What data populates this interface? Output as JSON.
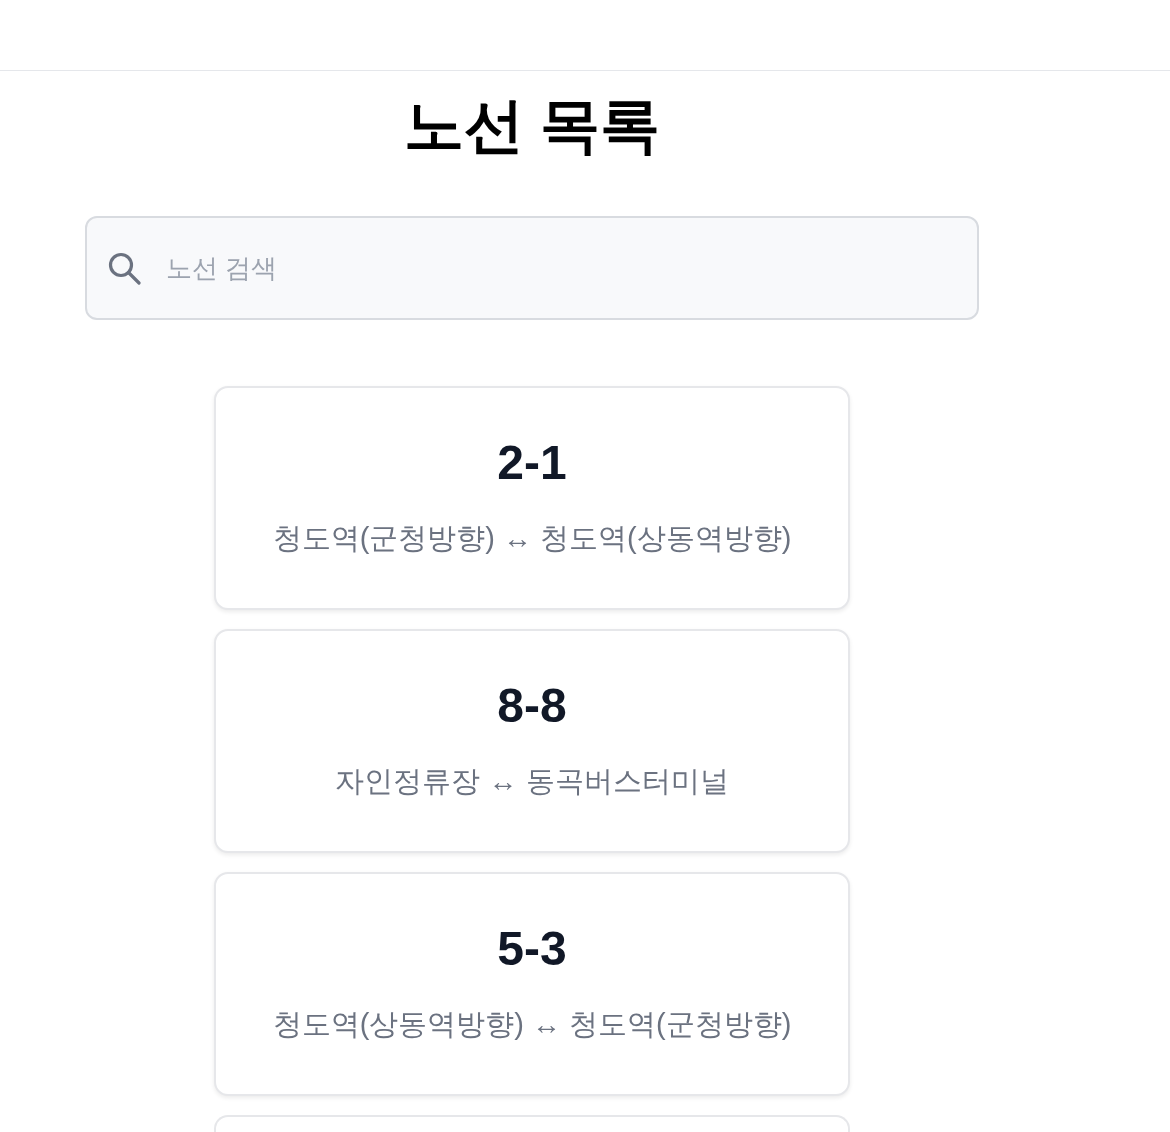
{
  "title": "노선 목록",
  "search": {
    "placeholder": "노선 검색"
  },
  "routes": [
    {
      "number": "2-1",
      "description": "청도역(군청방향) ↔ 청도역(상동역방향)"
    },
    {
      "number": "8-8",
      "description": "자인정류장 ↔ 동곡버스터미널"
    },
    {
      "number": "5-3",
      "description": "청도역(상동역방향) ↔ 청도역(군청방향)"
    }
  ],
  "routes_continue": true
}
